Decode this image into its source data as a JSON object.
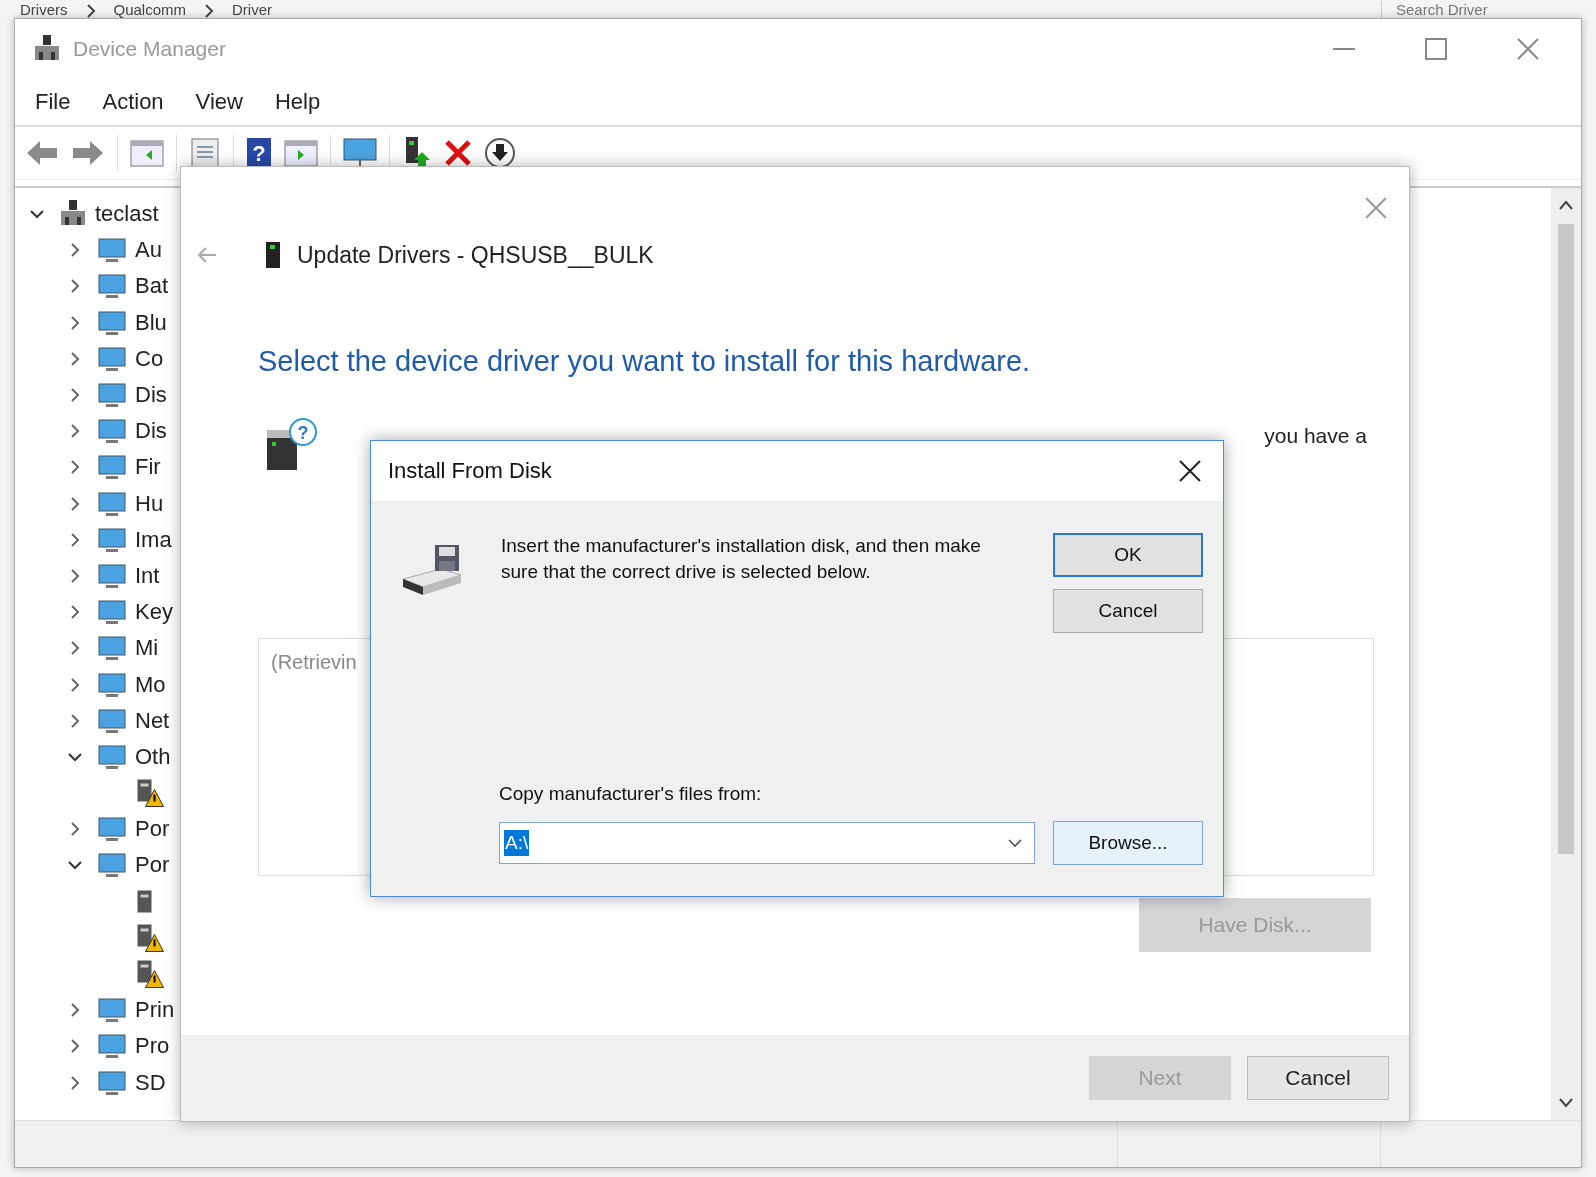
{
  "background_window": {
    "breadcrumbs": [
      "Drivers",
      "Qualcomm",
      "Driver"
    ],
    "search": {
      "placeholder": "Search Driver"
    }
  },
  "window": {
    "title": "Device Manager"
  },
  "menu": [
    "File",
    "Action",
    "View",
    "Help"
  ],
  "toolbar_help_glyph": "?",
  "wizard_icon_glyph": "?",
  "tree": {
    "label": "teclast",
    "expanded": true,
    "children": [
      {
        "label": "Au",
        "expanded": false
      },
      {
        "label": "Bat",
        "expanded": false
      },
      {
        "label": "Blu",
        "expanded": false
      },
      {
        "label": "Co",
        "expanded": false
      },
      {
        "label": "Dis",
        "expanded": false
      },
      {
        "label": "Dis",
        "expanded": false
      },
      {
        "label": "Fir",
        "expanded": false
      },
      {
        "label": "Hu",
        "expanded": false
      },
      {
        "label": "Ima",
        "expanded": false
      },
      {
        "label": "Int",
        "expanded": false
      },
      {
        "label": "Key",
        "expanded": false
      },
      {
        "label": "Mi",
        "expanded": false
      },
      {
        "label": "Mo",
        "expanded": false
      },
      {
        "label": "Net",
        "expanded": false
      },
      {
        "label": "Oth",
        "expanded": true,
        "children": [
          {
            "warning": true
          }
        ]
      },
      {
        "label": "Por",
        "expanded": false
      },
      {
        "label": "Por",
        "expanded": true,
        "children": [
          {
            "warning": false
          },
          {
            "warning": true
          },
          {
            "warning": true
          }
        ]
      },
      {
        "label": "Prin",
        "expanded": false
      },
      {
        "label": "Pro",
        "expanded": false
      },
      {
        "label": "SD",
        "expanded": false
      }
    ]
  },
  "wizard": {
    "title": "Update Drivers - QHSUSB__BULK",
    "heading": "Select the device driver you want to install for this hardware.",
    "instruction_visible": "you have a",
    "list_text": "(Retrievin",
    "have_disk": {
      "label": "Have Disk...",
      "disabled": true
    },
    "buttons": [
      {
        "label": "Next",
        "disabled": true
      },
      {
        "label": "Cancel",
        "disabled": false
      }
    ]
  },
  "dialog": {
    "title": "Install From Disk",
    "message": "Insert the manufacturer's installation disk, and then make sure that the correct drive is selected below.",
    "buttons": [
      {
        "label": "OK",
        "default": true
      },
      {
        "label": "Cancel",
        "default": false
      }
    ],
    "path_label": "Copy manufacturer's files from:",
    "path": {
      "value": "A:\\",
      "selected": true
    },
    "browse": "Browse..."
  }
}
